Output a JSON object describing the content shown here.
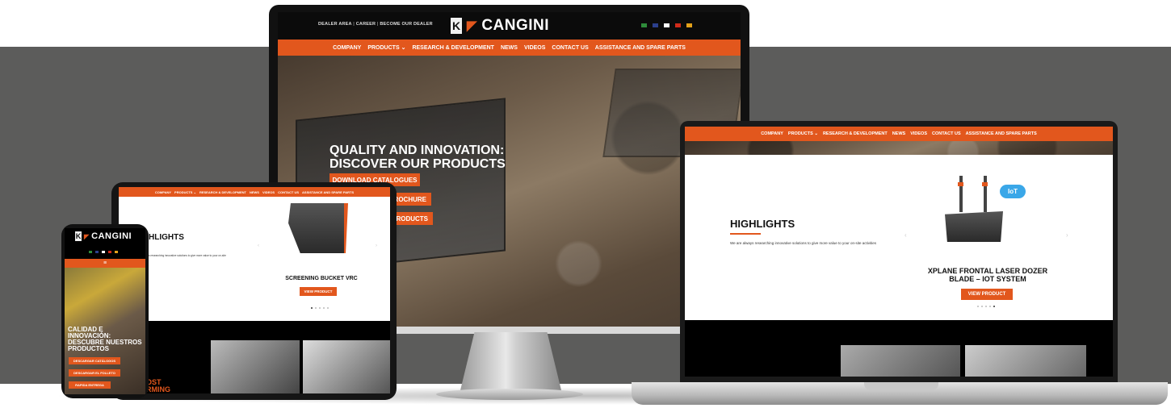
{
  "site": {
    "brand_name": "CANGINI",
    "brand_mark": "K",
    "top_links": [
      "DEALER AREA",
      "CAREER",
      "BECOME OUR DEALER"
    ],
    "nav": [
      "COMPANY",
      "PRODUCTS",
      "RESEARCH & DEVELOPMENT",
      "NEWS",
      "VIDEOS",
      "CONTACT US",
      "ASSISTANCE AND SPARE PARTS"
    ],
    "flags": [
      {
        "name": "italy-flag",
        "color": "#2e8b3a"
      },
      {
        "name": "uk-flag",
        "color": "#2b3f8c"
      },
      {
        "name": "france-flag",
        "color": "#ffffff"
      },
      {
        "name": "germany-flag",
        "color": "#d12a1a"
      },
      {
        "name": "spain-flag",
        "color": "#e3a21a"
      }
    ],
    "accent": "#e2571d"
  },
  "desktop": {
    "hero_title_1": "QUALITY AND INNOVATION:",
    "hero_title_2": "DISCOVER OUR PRODUCTS",
    "buttons": [
      "DOWNLOAD CATALOGUES",
      "BROCHURE",
      "PRODUCTS"
    ]
  },
  "laptop": {
    "highlights_title": "HIGHLIGHTS",
    "highlights_sub": "We are always researching innovative solutions to give more value to your on-site activities",
    "product_title_1": "XPLANE FRONTAL LASER DOZER",
    "product_title_2": "BLADE – IOT SYSTEM",
    "view_button": "VIEW PRODUCT",
    "iot_badge": "IoT"
  },
  "tablet": {
    "highlights_title": "HLIGHTS",
    "highlights_sub": "s researching innovative solutions to give more value to your on-site",
    "product_title": "SCREENING BUCKET VRC",
    "view_button": "VIEW PRODUCT",
    "bottom_text_1": "OST",
    "bottom_text_2": "RMING"
  },
  "phone": {
    "menu_icon": "≡",
    "hero_1": "CALIDAD E",
    "hero_2": "INNOVACIÓN:",
    "hero_3": "DESCUBRE NUESTROS",
    "hero_4": "PRODUCTOS",
    "buttons": [
      "DESCARGAR CATÁLOGOS",
      "DESCARGAR EL FOLLETO",
      "RAPIDA ENTREGA"
    ]
  }
}
